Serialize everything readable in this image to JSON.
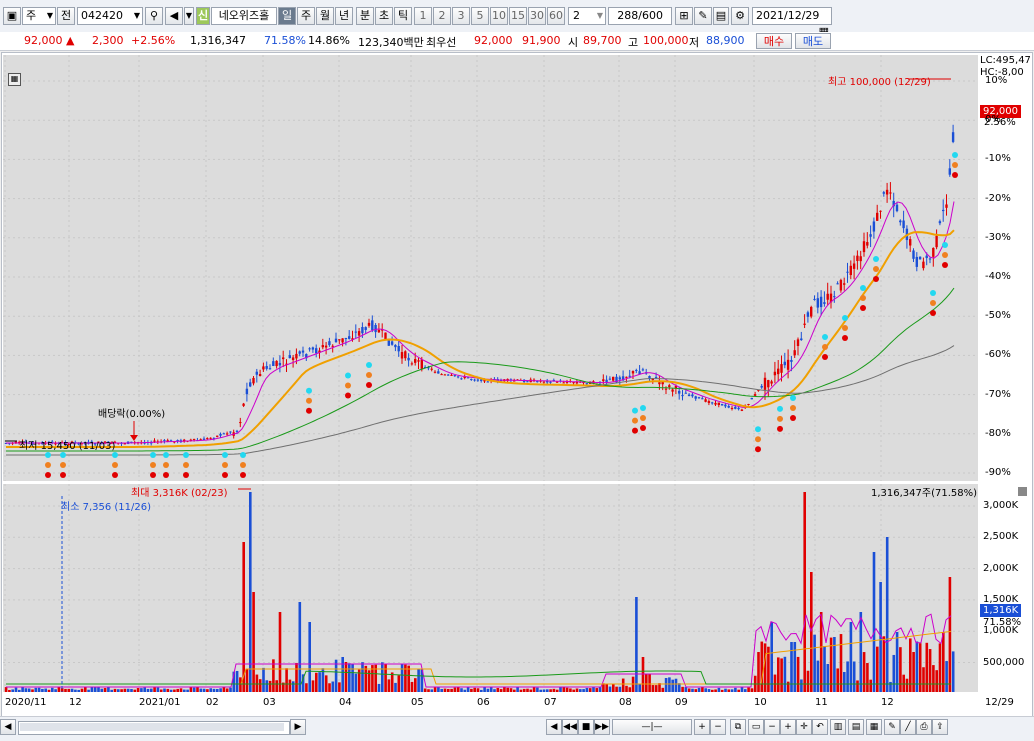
{
  "toolbar": {
    "type_label": "주",
    "type2_label": "전",
    "code": "042420",
    "sin_label": "신",
    "stock_name": "네오위즈홀",
    "periods": [
      "일",
      "주",
      "월",
      "년",
      "분",
      "초",
      "틱"
    ],
    "active_period": "일",
    "intervals": [
      "1",
      "2",
      "3",
      "5",
      "10",
      "15",
      "30",
      "60"
    ],
    "count_value": "2",
    "range": "288",
    "range_max": "/600",
    "date": "2021/12/29"
  },
  "quote": {
    "price": "92,000",
    "arrow": "▲",
    "change": "2,300",
    "change_pct": "+2.56%",
    "volume": "1,316,347",
    "vol_ratio": "71.58%",
    "turnover": "14.86%",
    "amount": "123,340백만",
    "best_label": "최우선",
    "ask": "92,000",
    "bid": "91,900",
    "open_label": "시",
    "open": "89,700",
    "high_label": "고",
    "high": "100,000",
    "low_label": "저",
    "low": "88,900",
    "buy_label": "매수",
    "sell_label": "매도"
  },
  "price_pane": {
    "lc_label": "LC:495,47",
    "hc_label": "HC:-8,00",
    "y_ticks": [
      "10%",
      "0%",
      "-10%",
      "-20%",
      "-30%",
      "-40%",
      "-50%",
      "-60%",
      "-70%",
      "-80%",
      "-90%"
    ],
    "current_tag": "92,000",
    "current_pct": "2.56%",
    "max_label": "최고 100,000 (12/29)",
    "min_label": "최저 15,450 (11/03)",
    "dividend_label": "배당락(0.00%)"
  },
  "volume_pane": {
    "y_ticks": [
      "3,000K",
      "2,500K",
      "2,000K",
      "1,500K",
      "1,000K",
      "500,000"
    ],
    "current_vol": "1,316,347주(71.58%)",
    "vol_tag": "1,316K",
    "vol_pct": "71.58%",
    "max_label": "최대 3,316K (02/23)",
    "min_label": "최소 7,356 (11/26)"
  },
  "x_axis": [
    "2020/11",
    "12",
    "2021/01",
    "02",
    "03",
    "04",
    "05",
    "06",
    "07",
    "08",
    "09",
    "10",
    "11",
    "12",
    "12/29"
  ],
  "colors": {
    "up": "#e00000",
    "down": "#1a4fd6",
    "ma5": "#cc00cc",
    "ma20": "#f0a000",
    "ma60": "#1a9a1a",
    "ma120": "#707070"
  }
}
